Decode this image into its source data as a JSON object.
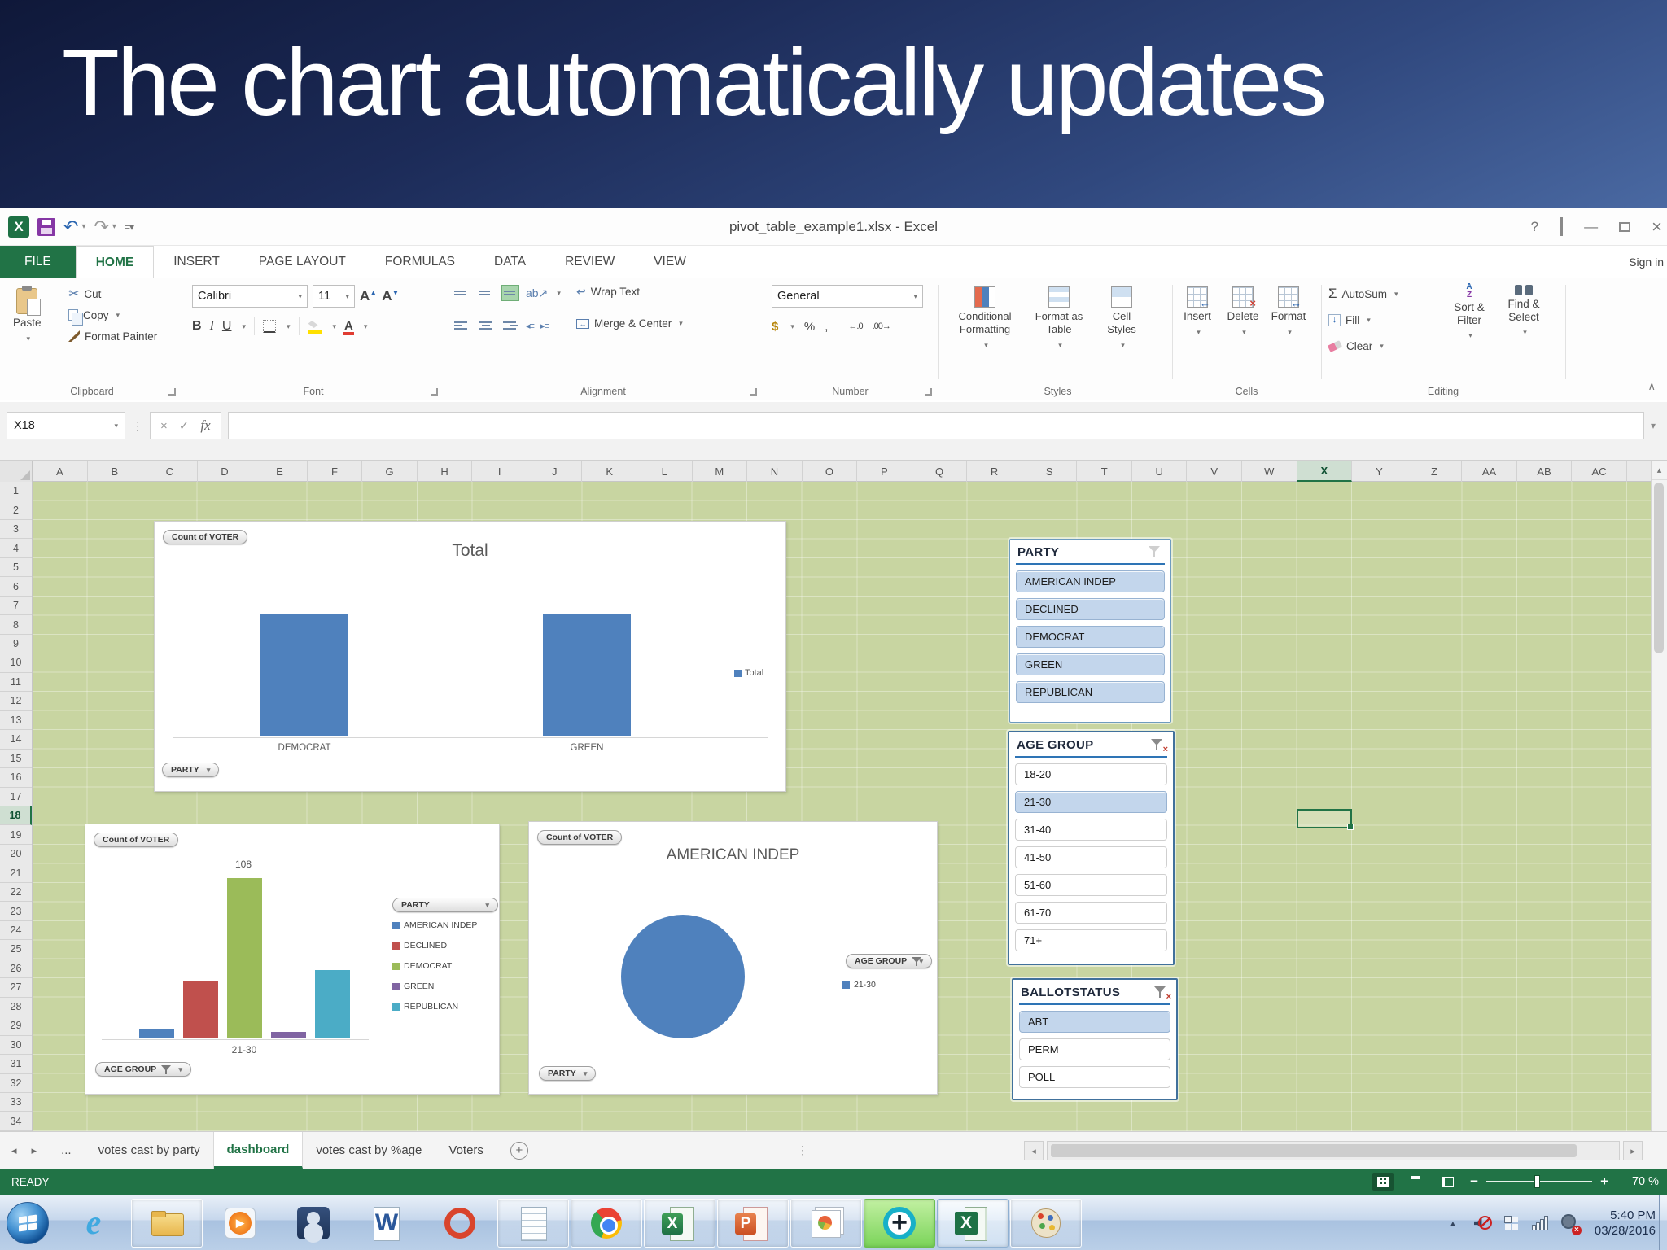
{
  "banner": {
    "title": "The chart automatically updates"
  },
  "titlebar": {
    "title": "pivot_table_example1.xlsx - Excel"
  },
  "ribbon": {
    "sign_in": "Sign in",
    "tabs": [
      {
        "label": "FILE",
        "active": false
      },
      {
        "label": "HOME",
        "active": true
      },
      {
        "label": "INSERT",
        "active": false
      },
      {
        "label": "PAGE LAYOUT",
        "active": false
      },
      {
        "label": "FORMULAS",
        "active": false
      },
      {
        "label": "DATA",
        "active": false
      },
      {
        "label": "REVIEW",
        "active": false
      },
      {
        "label": "VIEW",
        "active": false
      }
    ],
    "clipboard": {
      "group": "Clipboard",
      "paste": "Paste",
      "cut": "Cut",
      "copy": "Copy",
      "format_painter": "Format Painter"
    },
    "font": {
      "group": "Font",
      "font_name": "Calibri",
      "font_size": "11",
      "bold": "B",
      "italic": "I",
      "underline": "U"
    },
    "alignment": {
      "group": "Alignment",
      "wrap_text": "Wrap Text",
      "merge_center": "Merge & Center"
    },
    "number": {
      "group": "Number",
      "format": "General",
      "currency": "$",
      "percent": "%",
      "comma": ",",
      "increase_decimal": "←.0",
      "decrease_decimal": ".00→"
    },
    "styles": {
      "group": "Styles",
      "conditional": "Conditional Formatting",
      "format_table": "Format as Table",
      "cell_styles": "Cell Styles"
    },
    "cells": {
      "group": "Cells",
      "insert": "Insert",
      "delete": "Delete",
      "format": "Format"
    },
    "editing": {
      "group": "Editing",
      "autosum": "AutoSum",
      "fill": "Fill",
      "clear": "Clear",
      "sort_filter": "Sort & Filter",
      "find_select": "Find & Select"
    }
  },
  "formula_bar": {
    "name_box": "X18",
    "fx": "fx"
  },
  "grid": {
    "columns": [
      "A",
      "B",
      "C",
      "D",
      "E",
      "F",
      "G",
      "H",
      "I",
      "J",
      "K",
      "L",
      "M",
      "N",
      "O",
      "P",
      "Q",
      "R",
      "S",
      "T",
      "U",
      "V",
      "W",
      "X",
      "Y",
      "Z",
      "AA",
      "AB",
      "AC"
    ],
    "rows": 34,
    "selected_cell": "X18",
    "selected_column": "X",
    "selected_row": 18
  },
  "chart_data": [
    {
      "id": "total-by-party-column",
      "type": "bar",
      "title": "Total",
      "field_button": "Count of VOTER",
      "axis_filter_button": "PARTY",
      "categories": [
        "DEMOCRAT",
        "GREEN"
      ],
      "relative_heights": [
        0.45,
        0.45
      ],
      "values_labeled": false,
      "legend": [
        "Total"
      ],
      "bar_color": "#4f81bd"
    },
    {
      "id": "count-by-party-age-21-30",
      "type": "bar",
      "field_button": "Count of VOTER",
      "categories": [
        "21-30"
      ],
      "series": [
        {
          "name": "AMERICAN INDEP",
          "value": 6,
          "color": "#4f81bd"
        },
        {
          "name": "DECLINED",
          "value": 38,
          "color": "#c0504d"
        },
        {
          "name": "DEMOCRAT",
          "value": 108,
          "color": "#9bbb59"
        },
        {
          "name": "GREEN",
          "value": 4,
          "color": "#8064a2"
        },
        {
          "name": "REPUBLICAN",
          "value": 46,
          "color": "#4bacc6"
        }
      ],
      "data_label": {
        "series": "DEMOCRAT",
        "text": "108"
      },
      "legend_title_button": "PARTY",
      "axis_filter_button": "AGE GROUP",
      "ylim": [
        0,
        115
      ]
    },
    {
      "id": "american-indep-pie",
      "type": "pie",
      "title": "AMERICAN INDEP",
      "field_button": "Count of VOTER",
      "slices": [
        {
          "label": "21-30",
          "value": 100,
          "color": "#4f81bd"
        }
      ],
      "filter_button": "AGE GROUP",
      "bottom_filter_button": "PARTY"
    }
  ],
  "slicers": [
    {
      "title": "PARTY",
      "filter_active": false,
      "items": [
        {
          "label": "AMERICAN INDEP",
          "selected": true
        },
        {
          "label": "DECLINED",
          "selected": true
        },
        {
          "label": "DEMOCRAT",
          "selected": true
        },
        {
          "label": "GREEN",
          "selected": true
        },
        {
          "label": "REPUBLICAN",
          "selected": true
        }
      ]
    },
    {
      "title": "AGE GROUP",
      "filter_active": true,
      "items": [
        {
          "label": "18-20",
          "selected": false
        },
        {
          "label": "21-30",
          "selected": true
        },
        {
          "label": "31-40",
          "selected": false
        },
        {
          "label": "41-50",
          "selected": false
        },
        {
          "label": "51-60",
          "selected": false
        },
        {
          "label": "61-70",
          "selected": false
        },
        {
          "label": "71+",
          "selected": false
        }
      ]
    },
    {
      "title": "BALLOTSTATUS",
      "filter_active": true,
      "items": [
        {
          "label": "ABT",
          "selected": true
        },
        {
          "label": "PERM",
          "selected": false
        },
        {
          "label": "POLL",
          "selected": false
        }
      ]
    }
  ],
  "sheet_tabs": [
    {
      "label": "...",
      "active": false
    },
    {
      "label": "votes cast by party",
      "active": false
    },
    {
      "label": "dashboard",
      "active": true
    },
    {
      "label": "votes cast by %age",
      "active": false
    },
    {
      "label": "Voters",
      "active": false
    }
  ],
  "status_bar": {
    "mode": "READY",
    "zoom": "70 %"
  },
  "taskbar": {
    "icons": [
      {
        "name": "start",
        "framed": false
      },
      {
        "name": "internet-explorer",
        "framed": false
      },
      {
        "name": "file-explorer",
        "framed": true
      },
      {
        "name": "media-player",
        "framed": false
      },
      {
        "name": "user-account",
        "framed": false
      },
      {
        "name": "word",
        "framed": false
      },
      {
        "name": "media-center-red",
        "framed": false
      },
      {
        "name": "notepad",
        "framed": true
      },
      {
        "name": "chrome",
        "framed": true
      },
      {
        "name": "excel-classic",
        "framed": true
      },
      {
        "name": "powerpoint",
        "framed": true
      },
      {
        "name": "photo-viewer",
        "framed": true
      },
      {
        "name": "capture-plus",
        "framed": true
      },
      {
        "name": "excel",
        "framed": true,
        "active": true
      },
      {
        "name": "paint",
        "framed": true
      }
    ],
    "tray_icons": [
      "show-hidden-icons",
      "volume-muted",
      "network",
      "signal-strength",
      "sync-error"
    ],
    "clock": {
      "time": "5:40 PM",
      "date": "03/28/2016"
    }
  },
  "colors": {
    "excel_green": "#217346",
    "bar_blue": "#4f81bd",
    "sheet_green": "#c8d5a1",
    "slicer_selected": "#c3d6ec"
  }
}
